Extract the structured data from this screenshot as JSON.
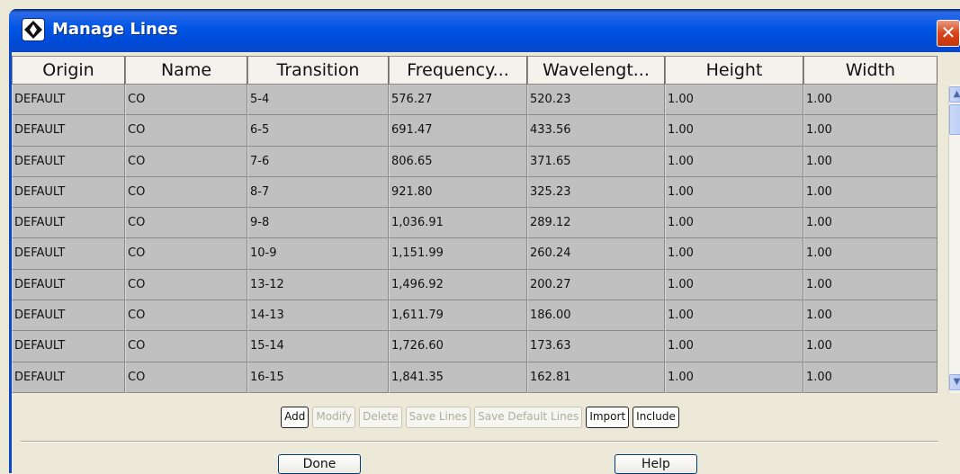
{
  "window": {
    "title": "Manage Lines",
    "close_symbol": "✕"
  },
  "table": {
    "columns": [
      "Origin",
      "Name",
      "Transition",
      "Frequency...",
      "Wavelengt...",
      "Height",
      "Width"
    ],
    "rows": [
      [
        "DEFAULT",
        "CO",
        "5-4",
        "576.27",
        "520.23",
        "1.00",
        "1.00"
      ],
      [
        "DEFAULT",
        "CO",
        "6-5",
        "691.47",
        "433.56",
        "1.00",
        "1.00"
      ],
      [
        "DEFAULT",
        "CO",
        "7-6",
        "806.65",
        "371.65",
        "1.00",
        "1.00"
      ],
      [
        "DEFAULT",
        "CO",
        "8-7",
        "921.80",
        "325.23",
        "1.00",
        "1.00"
      ],
      [
        "DEFAULT",
        "CO",
        "9-8",
        "1,036.91",
        "289.12",
        "1.00",
        "1.00"
      ],
      [
        "DEFAULT",
        "CO",
        "10-9",
        "1,151.99",
        "260.24",
        "1.00",
        "1.00"
      ],
      [
        "DEFAULT",
        "CO",
        "13-12",
        "1,496.92",
        "200.27",
        "1.00",
        "1.00"
      ],
      [
        "DEFAULT",
        "CO",
        "14-13",
        "1,611.79",
        "186.00",
        "1.00",
        "1.00"
      ],
      [
        "DEFAULT",
        "CO",
        "15-14",
        "1,726.60",
        "173.63",
        "1.00",
        "1.00"
      ],
      [
        "DEFAULT",
        "CO",
        "16-15",
        "1,841.35",
        "162.81",
        "1.00",
        "1.00"
      ]
    ]
  },
  "scrollbar": {
    "up_symbol": "▲",
    "down_symbol": "▼"
  },
  "actions": {
    "add": "Add",
    "modify": "Modify",
    "delete": "Delete",
    "save_lines": "Save Lines",
    "save_default_lines": "Save Default Lines",
    "import": "Import",
    "include": "Include"
  },
  "footer": {
    "done": "Done",
    "help": "Help"
  },
  "colors": {
    "titlebar": "#0055e5",
    "row_bg": "#c0c0c0",
    "close": "#d9441a"
  }
}
